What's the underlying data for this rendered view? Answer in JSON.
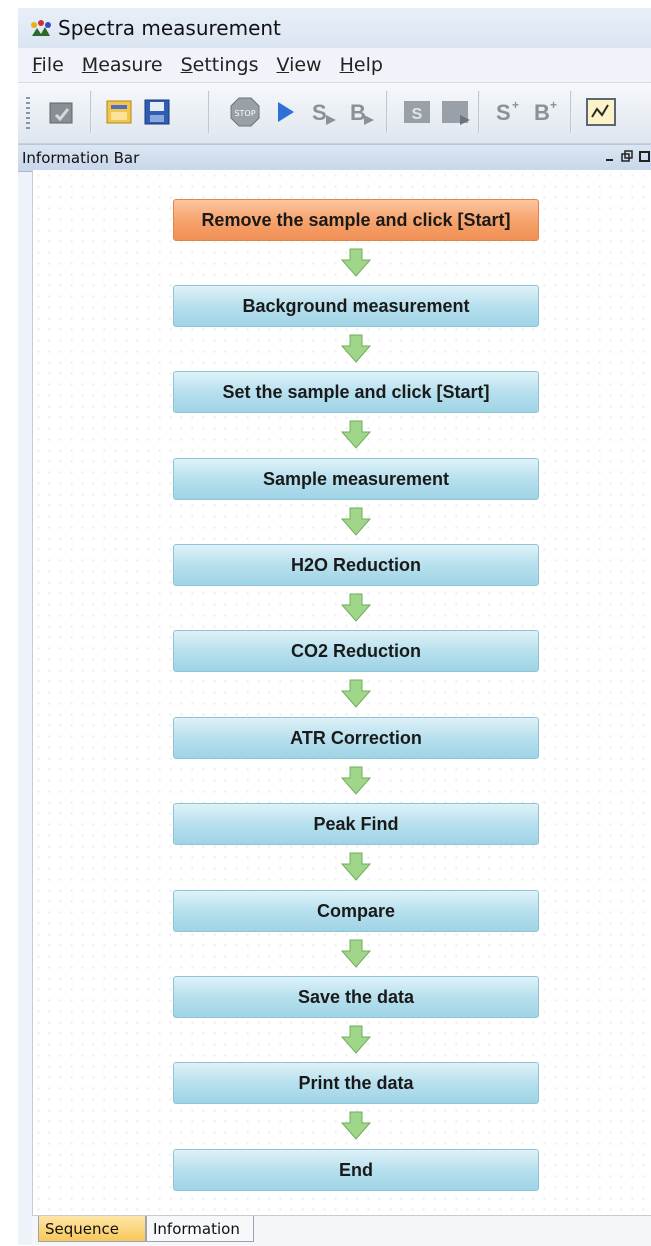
{
  "window": {
    "title": "Spectra measurement",
    "icon": "spectra-app-icon"
  },
  "menu": [
    {
      "label": "File"
    },
    {
      "label": "Measure"
    },
    {
      "label": "Settings"
    },
    {
      "label": "View"
    },
    {
      "label": "Help"
    }
  ],
  "toolbar": {
    "buttons": [
      "new-icon",
      "open-folder-icon",
      "save-icon",
      "stop-icon",
      "play-icon",
      "sample-arrow-icon",
      "background-arrow-icon",
      "sample-multi-icon",
      "background-multi-icon",
      "sample-series-icon",
      "background-series-icon",
      "monitor-icon"
    ],
    "stop_label": "STOP"
  },
  "info_bar": {
    "title": "Information Bar",
    "controls": [
      "minimize-icon",
      "restore-icon",
      "maximize-icon"
    ]
  },
  "sequence": {
    "active_color": "#f49a60",
    "step_color": "#b7e0ee",
    "arrow_color": "#9fd68a",
    "steps": [
      {
        "label": "Remove the sample and click [Start]",
        "active": true
      },
      {
        "label": "Background measurement",
        "active": false
      },
      {
        "label": "Set the sample and click [Start]",
        "active": false
      },
      {
        "label": "Sample measurement",
        "active": false
      },
      {
        "label": "H2O Reduction",
        "active": false
      },
      {
        "label": "CO2 Reduction",
        "active": false
      },
      {
        "label": "ATR Correction",
        "active": false
      },
      {
        "label": "Peak Find",
        "active": false
      },
      {
        "label": "Compare",
        "active": false
      },
      {
        "label": "Save the data",
        "active": false
      },
      {
        "label": "Print the data",
        "active": false
      },
      {
        "label": "End",
        "active": false
      }
    ]
  },
  "tabs": [
    {
      "label": "Sequence",
      "selected": true
    },
    {
      "label": "Information",
      "selected": false
    }
  ]
}
